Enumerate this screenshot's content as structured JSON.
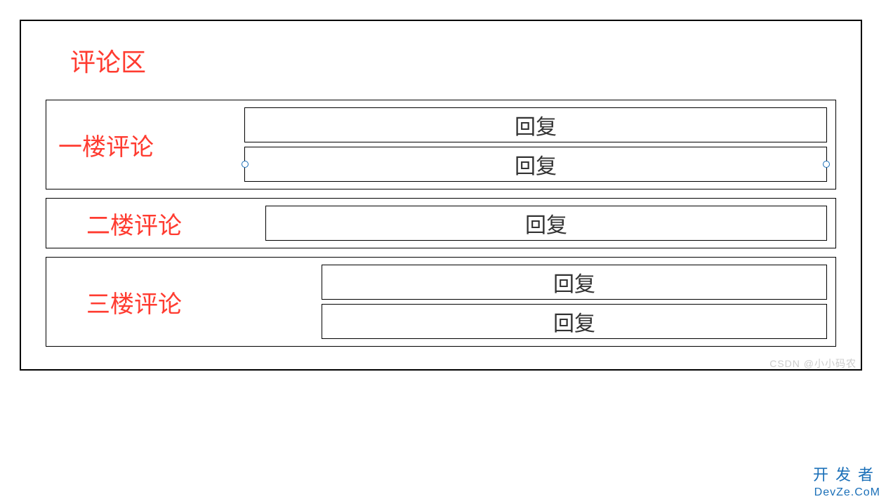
{
  "section_title": "评论区",
  "comments": [
    {
      "label": "一楼评论",
      "replies": [
        "回复",
        "回复"
      ]
    },
    {
      "label": "二楼评论",
      "replies": [
        "回复"
      ]
    },
    {
      "label": "三楼评论",
      "replies": [
        "回复",
        "回复"
      ]
    }
  ],
  "watermark": "CSDN @小小码农",
  "brand_cn": "开发者",
  "brand_en": "DevZe.CoM"
}
